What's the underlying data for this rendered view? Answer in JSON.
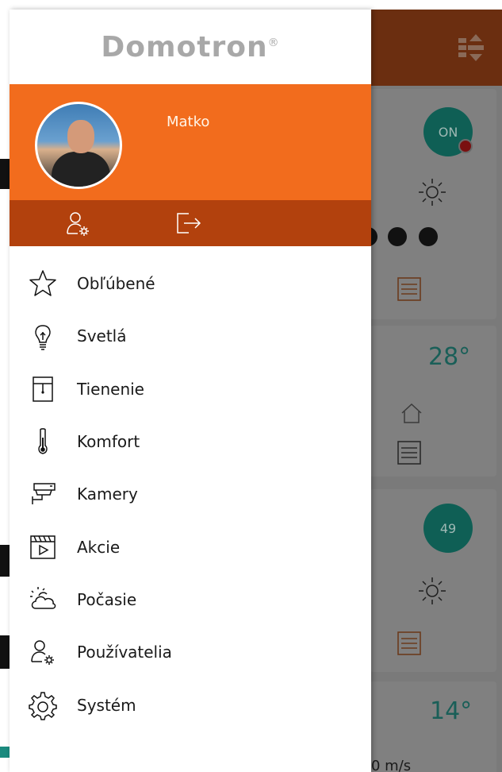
{
  "app": {
    "logo_text": "Domotron",
    "logo_mark": "®"
  },
  "profile": {
    "username": "Matko"
  },
  "actions": [
    {
      "name": "user-settings",
      "icon": "user-gear-icon"
    },
    {
      "name": "logout",
      "icon": "logout-icon"
    }
  ],
  "menu": {
    "items": [
      {
        "label": "Obľúbené",
        "icon": "star-icon"
      },
      {
        "label": "Svetlá",
        "icon": "lightbulb-icon"
      },
      {
        "label": "Tienenie",
        "icon": "blinds-icon"
      },
      {
        "label": "Komfort",
        "icon": "thermometer-icon"
      },
      {
        "label": "Kamery",
        "icon": "camera-icon"
      },
      {
        "label": "Akcie",
        "icon": "clapperboard-icon"
      },
      {
        "label": "Počasie",
        "icon": "weather-icon"
      },
      {
        "label": "Používatelia",
        "icon": "users-gear-icon"
      },
      {
        "label": "Systém",
        "icon": "gear-icon"
      }
    ]
  },
  "background": {
    "on_badge": "ON",
    "temp_1": "28°",
    "circle_value": "49",
    "temp_2": "14°",
    "wind": "0 m/s"
  },
  "colors": {
    "accent": "#f26c1d",
    "accent_dark": "#b2410d",
    "teal": "#1a8a7e",
    "logo_grey": "#a8a8a8"
  }
}
